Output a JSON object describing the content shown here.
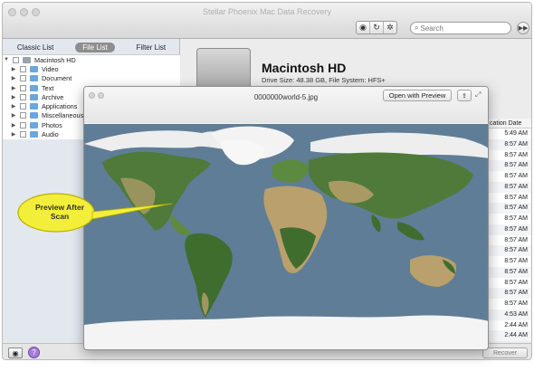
{
  "window": {
    "title": "Stellar Phoenix Mac Data Recovery"
  },
  "toolbar": {
    "eye_icon": "eye-icon",
    "refresh_icon": "refresh-icon",
    "gear_icon": "gear-icon",
    "search_placeholder": "Search",
    "go_icon": "forward-icon"
  },
  "sidebar": {
    "tabs": [
      {
        "label": "Classic List",
        "active": false
      },
      {
        "label": "File List",
        "active": true
      },
      {
        "label": "Filter List",
        "active": false
      }
    ],
    "tree": {
      "root": "Macintosh HD",
      "items": [
        {
          "label": "Video"
        },
        {
          "label": "Document"
        },
        {
          "label": "Text"
        },
        {
          "label": "Archive"
        },
        {
          "label": "Applications"
        },
        {
          "label": "Miscellaneous"
        },
        {
          "label": "Photos"
        },
        {
          "label": "Audio"
        }
      ]
    }
  },
  "drive": {
    "name": "Macintosh HD",
    "info": "Drive Size: 48.38 GB, File System: HFS+"
  },
  "file_list": {
    "date_header": "cation Date",
    "dates": [
      "5:49 AM",
      "8:57 AM",
      "8:57 AM",
      "8:57 AM",
      "8:57 AM",
      "8:57 AM",
      "8:57 AM",
      "8:57 AM",
      "8:57 AM",
      "8:57 AM",
      "8:57 AM",
      "8:57 AM",
      "8:57 AM",
      "8:57 AM",
      "8:57 AM",
      "8:57 AM",
      "8:57 AM",
      "4:53 AM",
      "2:44 AM",
      "2:44 AM",
      "2:44 AM"
    ]
  },
  "preview": {
    "filename": "0000000world-5.jpg",
    "open_button": "Open with Preview",
    "share_icon": "share-icon",
    "expand_icon": "expand-icon"
  },
  "callout": {
    "text_line1": "Preview After",
    "text_line2": "Scan"
  },
  "bottom": {
    "recover_label": "Recover",
    "help_label": "?"
  },
  "colors": {
    "ocean": "#5f7d96",
    "land_green": "#4f7a3a",
    "desert": "#b9a06c",
    "ice": "#f2f2f2",
    "callout_fill": "#f3ee3a",
    "active_tab": "#8e8e8e"
  }
}
